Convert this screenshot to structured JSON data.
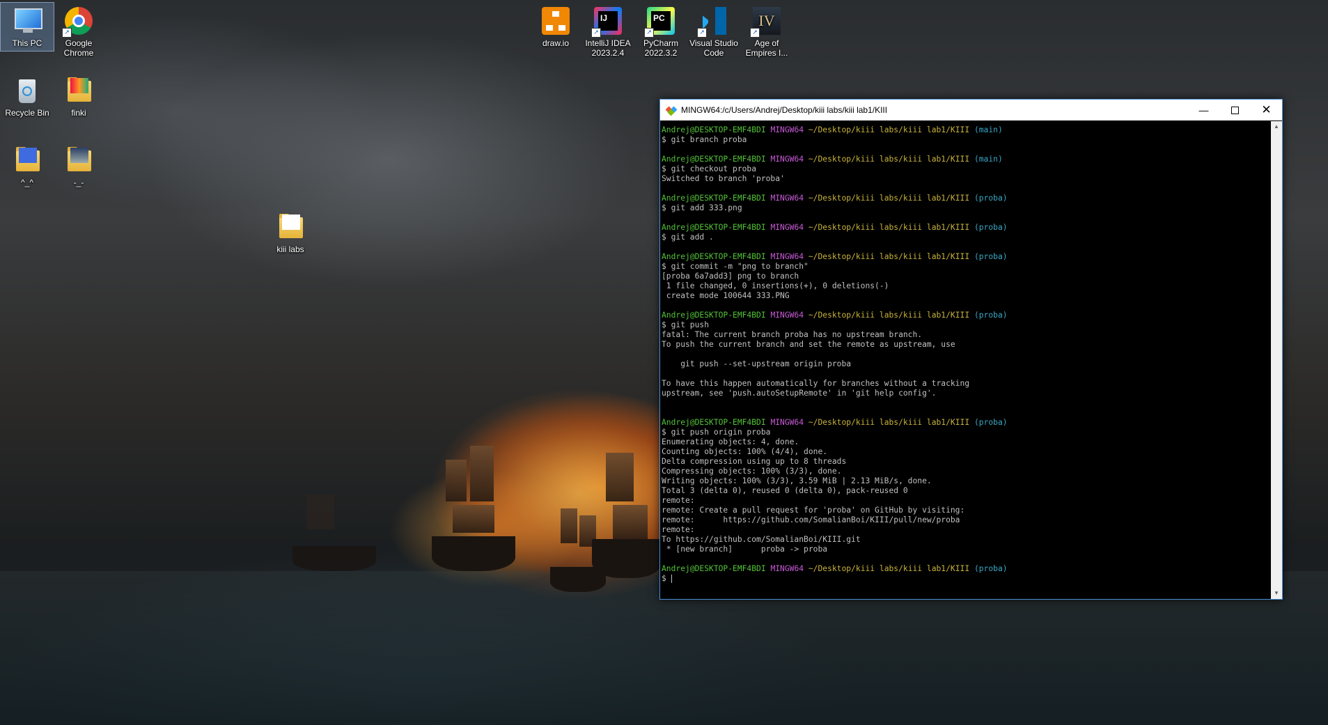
{
  "desktop": {
    "icons": [
      {
        "label": "This PC",
        "icon": "computer-icon"
      },
      {
        "label": "Google Chrome",
        "icon": "chrome-icon"
      },
      {
        "label": "Recycle Bin",
        "icon": "recycle-bin-icon"
      },
      {
        "label": "finki",
        "icon": "folder-icon"
      },
      {
        "label": "^_^",
        "icon": "folder-icon"
      },
      {
        "label": "-_-",
        "icon": "folder-icon"
      },
      {
        "label": "kiii labs",
        "icon": "folder-icon"
      },
      {
        "label": "draw.io",
        "icon": "drawio-icon"
      },
      {
        "label": "IntelliJ IDEA 2023.2.4",
        "icon": "intellij-icon"
      },
      {
        "label": "PyCharm 2022.3.2",
        "icon": "pycharm-icon"
      },
      {
        "label": "Visual Studio Code",
        "icon": "vscode-icon"
      },
      {
        "label": "Age of Empires I...",
        "icon": "aoe-icon"
      }
    ]
  },
  "terminal": {
    "title": "MINGW64:/c/Users/Andrej/Desktop/kiii labs/kiii lab1/KIII",
    "prompt": {
      "user": "Andrej@DESKTOP-EMF4BDI",
      "system": "MINGW64",
      "path": "~/Desktop/kiii labs/kiii lab1/KIII"
    },
    "blocks": [
      {
        "branch": "(main)",
        "command": "$ git branch proba",
        "output": []
      },
      {
        "branch": "(main)",
        "command": "$ git checkout proba",
        "output": [
          "Switched to branch 'proba'"
        ]
      },
      {
        "branch": "(proba)",
        "command": "$ git add 333.png",
        "output": []
      },
      {
        "branch": "(proba)",
        "command": "$ git add .",
        "output": []
      },
      {
        "branch": "(proba)",
        "command": "$ git commit -m \"png to branch\"",
        "output": [
          "[proba 6a7add3] png to branch",
          " 1 file changed, 0 insertions(+), 0 deletions(-)",
          " create mode 100644 333.PNG"
        ]
      },
      {
        "branch": "(proba)",
        "command": "$ git push",
        "output": [
          "fatal: The current branch proba has no upstream branch.",
          "To push the current branch and set the remote as upstream, use",
          "",
          "    git push --set-upstream origin proba",
          "",
          "To have this happen automatically for branches without a tracking",
          "upstream, see 'push.autoSetupRemote' in 'git help config'.",
          ""
        ]
      },
      {
        "branch": "(proba)",
        "command": "$ git push origin proba",
        "output": [
          "Enumerating objects: 4, done.",
          "Counting objects: 100% (4/4), done.",
          "Delta compression using up to 8 threads",
          "Compressing objects: 100% (3/3), done.",
          "Writing objects: 100% (3/3), 3.59 MiB | 2.13 MiB/s, done.",
          "Total 3 (delta 0), reused 0 (delta 0), pack-reused 0",
          "remote:",
          "remote: Create a pull request for 'proba' on GitHub by visiting:",
          "remote:      https://github.com/SomalianBoi/KIII/pull/new/proba",
          "remote:",
          "To https://github.com/SomalianBoi/KIII.git",
          " * [new branch]      proba -> proba"
        ]
      },
      {
        "branch": "(proba)",
        "command": "$ ",
        "output": []
      }
    ]
  }
}
